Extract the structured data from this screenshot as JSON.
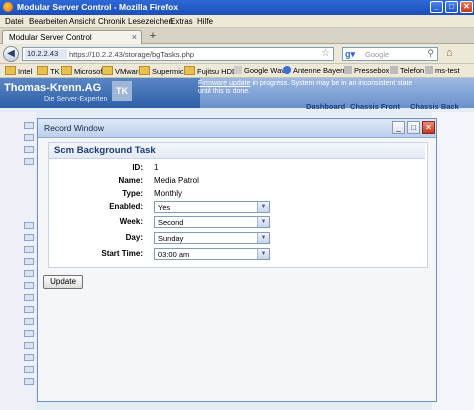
{
  "window": {
    "title": "Modular Server Control - Mozilla Firefox"
  },
  "menu": [
    "Datei",
    "Bearbeiten",
    "Ansicht",
    "Chronik",
    "Lesezeichen",
    "Extras",
    "Hilfe"
  ],
  "tab": {
    "label": "Modular Server Control"
  },
  "nav": {
    "host": "10.2.2.43",
    "url": "https://10.2.2.43/storage/bgTasks.php",
    "search_placeholder": "Google"
  },
  "bookmarks": [
    "Intel",
    "TK",
    "Microsoft",
    "VMware",
    "Supermicro",
    "Fujitsu HDD",
    "Google Wave",
    "Antenne Bayern",
    "Pressebox",
    "Telefon",
    "ms-test"
  ],
  "app": {
    "brand": "Thomas-Krenn.AG",
    "tagline": "Die Server-Experten",
    "logo": "TK",
    "notice_link": "Firmware update",
    "notice_line1": " in progress. System may be in an inconsistent state",
    "notice_line2": "until this is done.",
    "tabs": [
      "Dashboard",
      "Chassis Front",
      "Chassis Back"
    ]
  },
  "dialog": {
    "title": "Record Window",
    "heading": "Scm Background Task",
    "fields": [
      {
        "label": "ID:",
        "value": "1"
      },
      {
        "label": "Name:",
        "value": "Media Patrol"
      },
      {
        "label": "Type:",
        "value": "Monthly"
      },
      {
        "label": "Enabled:",
        "value": "Yes"
      },
      {
        "label": "Week:",
        "value": "Second"
      },
      {
        "label": "Day:",
        "value": "Sunday"
      },
      {
        "label": "Start Time:",
        "value": "03:00 am"
      }
    ],
    "update_label": "Update"
  },
  "colors": {
    "accent": "#2d5fa6",
    "titlebar": "#2356c4"
  }
}
